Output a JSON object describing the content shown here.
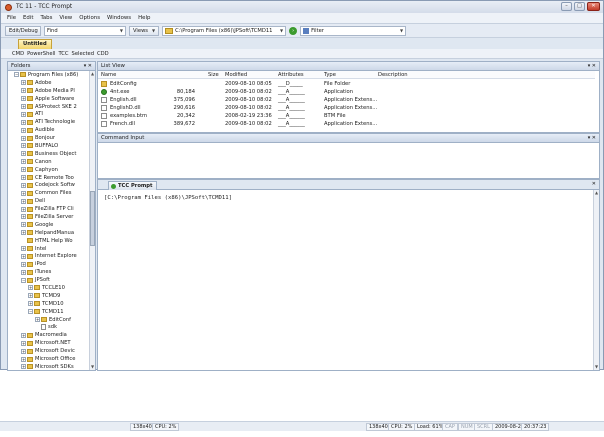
{
  "window": {
    "title": "TC 11 - TCC Prompt",
    "minimize": "–",
    "maximize": "□",
    "close": "✕"
  },
  "menu": [
    "File",
    "Edit",
    "Tabs",
    "View",
    "Options",
    "Windows",
    "Help"
  ],
  "toolbar": {
    "mode": "Edit/Debug",
    "find": "Find",
    "views": "Views",
    "path": "C:\\Program Files (x86)\\JPSoft\\TCMD11",
    "filter": "Filter"
  },
  "tabs": {
    "active": "Untitled"
  },
  "quick_buttons": [
    "CMD",
    "PowerShell",
    "TCC",
    "Selected",
    "CDD"
  ],
  "folders": {
    "title": "Folders",
    "pin": "▾ ✕",
    "items": [
      {
        "label": "Program Files (x86)",
        "depth": 0,
        "exp": "−",
        "icon": "folder"
      },
      {
        "label": "Adobe",
        "depth": 1,
        "exp": "+",
        "icon": "folder"
      },
      {
        "label": "Adobe Media Pl",
        "depth": 1,
        "exp": "+",
        "icon": "folder"
      },
      {
        "label": "Apple Software",
        "depth": 1,
        "exp": "+",
        "icon": "folder"
      },
      {
        "label": "ASProtect SKE 2",
        "depth": 1,
        "exp": "+",
        "icon": "folder"
      },
      {
        "label": "ATI",
        "depth": 1,
        "exp": "+",
        "icon": "folder"
      },
      {
        "label": "ATI Technologie",
        "depth": 1,
        "exp": "+",
        "icon": "folder"
      },
      {
        "label": "Audible",
        "depth": 1,
        "exp": "+",
        "icon": "folder"
      },
      {
        "label": "Bonjour",
        "depth": 1,
        "exp": "+",
        "icon": "folder"
      },
      {
        "label": "BUFFALO",
        "depth": 1,
        "exp": "+",
        "icon": "folder"
      },
      {
        "label": "Business Object",
        "depth": 1,
        "exp": "+",
        "icon": "folder"
      },
      {
        "label": "Canon",
        "depth": 1,
        "exp": "+",
        "icon": "folder"
      },
      {
        "label": "Caphyon",
        "depth": 1,
        "exp": "+",
        "icon": "folder"
      },
      {
        "label": "CE Remote Too",
        "depth": 1,
        "exp": "+",
        "icon": "folder"
      },
      {
        "label": "Codejock Softw",
        "depth": 1,
        "exp": "+",
        "icon": "folder"
      },
      {
        "label": "Common Files",
        "depth": 1,
        "exp": "+",
        "icon": "folder"
      },
      {
        "label": "Dell",
        "depth": 1,
        "exp": "+",
        "icon": "folder"
      },
      {
        "label": "FileZilla FTP Cli",
        "depth": 1,
        "exp": "+",
        "icon": "folder"
      },
      {
        "label": "FileZilla Server",
        "depth": 1,
        "exp": "+",
        "icon": "folder"
      },
      {
        "label": "Google",
        "depth": 1,
        "exp": "+",
        "icon": "folder"
      },
      {
        "label": "HelpandManua",
        "depth": 1,
        "exp": "+",
        "icon": "folder"
      },
      {
        "label": "HTML Help Wo",
        "depth": 1,
        "exp": "",
        "icon": "folder"
      },
      {
        "label": "Intel",
        "depth": 1,
        "exp": "+",
        "icon": "folder"
      },
      {
        "label": "Internet Explore",
        "depth": 1,
        "exp": "+",
        "icon": "folder"
      },
      {
        "label": "iPod",
        "depth": 1,
        "exp": "+",
        "icon": "folder"
      },
      {
        "label": "iTunes",
        "depth": 1,
        "exp": "+",
        "icon": "folder"
      },
      {
        "label": "JPSoft",
        "depth": 1,
        "exp": "−",
        "icon": "folder"
      },
      {
        "label": "TCCLE10",
        "depth": 2,
        "exp": "+",
        "icon": "folder"
      },
      {
        "label": "TCMD9",
        "depth": 2,
        "exp": "+",
        "icon": "folder"
      },
      {
        "label": "TCMD10",
        "depth": 2,
        "exp": "+",
        "icon": "folder"
      },
      {
        "label": "TCMD11",
        "depth": 2,
        "exp": "−",
        "icon": "folder"
      },
      {
        "label": "EditConf",
        "depth": 3,
        "exp": "+",
        "icon": "folder"
      },
      {
        "label": "sdk",
        "depth": 3,
        "exp": "",
        "icon": "file"
      },
      {
        "label": "Macromedia",
        "depth": 1,
        "exp": "+",
        "icon": "folder"
      },
      {
        "label": "Microsoft.NET",
        "depth": 1,
        "exp": "+",
        "icon": "folder"
      },
      {
        "label": "Microsoft Devic",
        "depth": 1,
        "exp": "+",
        "icon": "folder"
      },
      {
        "label": "Microsoft Office",
        "depth": 1,
        "exp": "+",
        "icon": "folder"
      },
      {
        "label": "Microsoft SDKs",
        "depth": 1,
        "exp": "+",
        "icon": "folder"
      }
    ]
  },
  "listview": {
    "title": "List View",
    "pin": "▾ ✕",
    "columns": [
      "Name",
      "Size",
      "Modified",
      "Attributes",
      "Type",
      "Description"
    ],
    "rows": [
      {
        "name": "EditConfig",
        "size": "",
        "modified": "2009-08-10  08:05",
        "attr": "___D_____",
        "type": "File Folder",
        "icon": "folder"
      },
      {
        "name": "4nt.exe",
        "size": "80,184",
        "modified": "2009-08-10  08:02",
        "attr": "___A______",
        "type": "Application",
        "icon": "app"
      },
      {
        "name": "English.dll",
        "size": "375,096",
        "modified": "2009-08-10  08:02",
        "attr": "___A______",
        "type": "Application Extens...",
        "icon": "file"
      },
      {
        "name": "EnglishD.dll",
        "size": "290,616",
        "modified": "2009-08-10  08:02",
        "attr": "___A______",
        "type": "Application Extens...",
        "icon": "file"
      },
      {
        "name": "examples.btm",
        "size": "20,342",
        "modified": "2008-02-19  23:36",
        "attr": "___A______",
        "type": "BTM File",
        "icon": "file"
      },
      {
        "name": "French.dll",
        "size": "389,672",
        "modified": "2009-08-10  08:02",
        "attr": "___A______",
        "type": "Application Extens...",
        "icon": "file"
      }
    ]
  },
  "command_input": {
    "title": "Command Input",
    "pin": "▾ ✕"
  },
  "console": {
    "tab": "TCC Prompt",
    "close": "✕",
    "prompt": "[C:\\Program Files (x86)\\JPSoft\\TCMD11]"
  },
  "statusbar": {
    "left_size": "138x40",
    "left_cpu": "CPU: 2%",
    "size": "138x40",
    "cpu": "CPU: 2%",
    "load": "Load: 61%",
    "caps": "CAP",
    "num": "NUM",
    "scroll": "SCRL",
    "date": "2009-08-20",
    "time": "20:37:23"
  }
}
